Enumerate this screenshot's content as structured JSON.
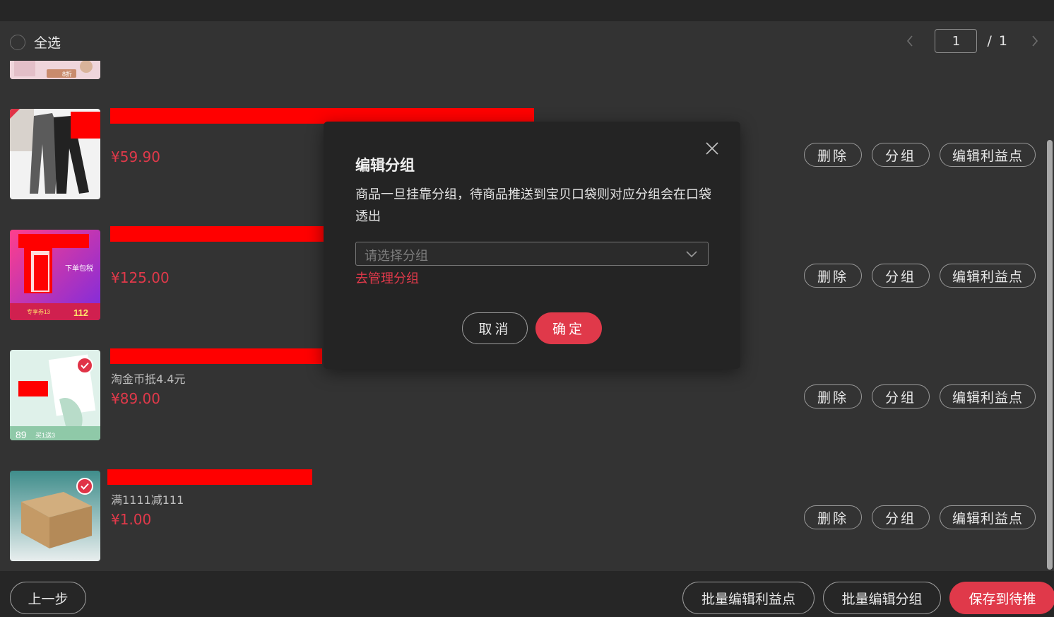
{
  "header": {
    "select_all_label": "全选",
    "pagination": {
      "current_page": "1",
      "total_text": "/ 1"
    }
  },
  "products": [
    {
      "subline": "",
      "price": "¥59.90",
      "selected": false
    },
    {
      "subline": "",
      "price": "¥125.00",
      "selected": false
    },
    {
      "subline": "淘金币抵4.4元",
      "price": "¥89.00",
      "selected": true
    },
    {
      "subline": "满1111减111",
      "price": "¥1.00",
      "selected": true
    }
  ],
  "product_images": [
    {
      "badge_text": ""
    },
    {
      "badge_text": "下单包税",
      "coupon_text": "专享券13",
      "price_tag": "112"
    },
    {
      "price_tag": "89",
      "promo_text": "买1送3"
    },
    {
      "badge_text": ""
    }
  ],
  "partial_item_tag": "8折",
  "row_actions": {
    "delete_label": "删除",
    "group_label": "分组",
    "edit_points_label": "编辑利益点"
  },
  "footer": {
    "prev_label": "上一步",
    "batch_edit_points_label": "批量编辑利益点",
    "batch_edit_group_label": "批量编辑分组",
    "save_label": "保存到待推"
  },
  "modal": {
    "title": "编辑分组",
    "description": "商品一旦挂靠分组，待商品推送到宝贝口袋则对应分组会在口袋透出",
    "select_placeholder": "请选择分组",
    "manage_link": "去管理分组",
    "cancel_label": "取消",
    "confirm_label": "确定"
  },
  "colors": {
    "accent": "#e0394a",
    "background": "#333333",
    "modal_background": "#242424",
    "redaction": "#ff0000"
  }
}
